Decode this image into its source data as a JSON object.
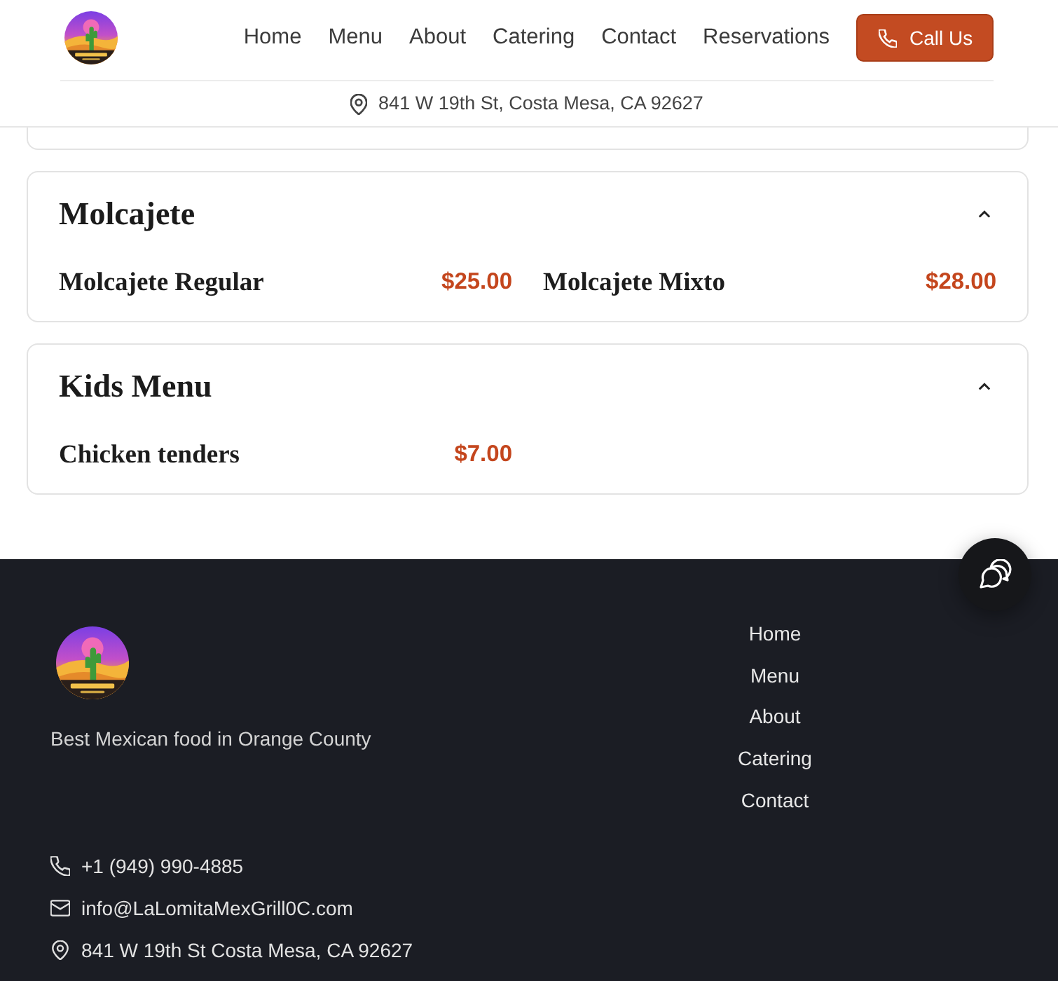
{
  "header": {
    "nav": [
      "Home",
      "Menu",
      "About",
      "Catering",
      "Contact",
      "Reservations"
    ],
    "call_button": "Call Us",
    "address": "841 W 19th St, Costa Mesa, CA 92627"
  },
  "menu_sections": [
    {
      "title": "Molcajete",
      "expanded": true,
      "items": [
        {
          "name": "Molcajete Regular",
          "price": "$25.00"
        },
        {
          "name": "Molcajete Mixto",
          "price": "$28.00"
        }
      ]
    },
    {
      "title": "Kids Menu",
      "expanded": true,
      "items": [
        {
          "name": "Chicken tenders",
          "price": "$7.00"
        }
      ]
    }
  ],
  "footer": {
    "tagline": "Best Mexican food in Orange County",
    "links": [
      "Home",
      "Menu",
      "About",
      "Catering",
      "Contact"
    ],
    "contacts": [
      {
        "kind": "phone",
        "text": "+1 (949) 990-4885"
      },
      {
        "kind": "email",
        "text": "info@LaLomitaMexGrill0C.com"
      },
      {
        "kind": "address",
        "text": "841 W 19th St Costa Mesa, CA 92627"
      }
    ]
  }
}
